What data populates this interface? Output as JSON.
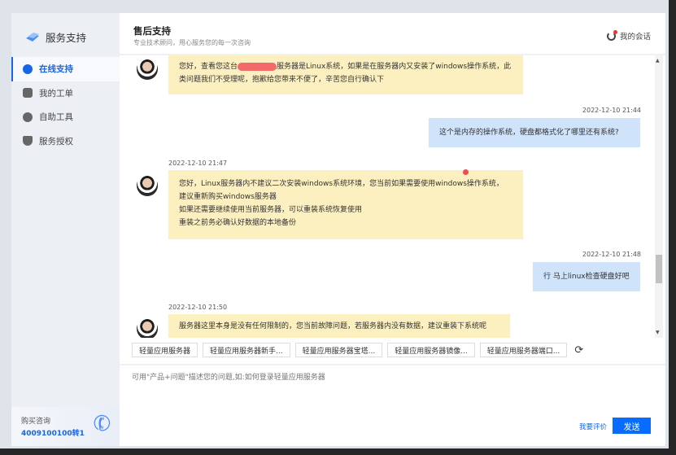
{
  "sidebar": {
    "brand": "服务支持",
    "items": [
      {
        "label": "在线支持",
        "icon": "chat-icon",
        "active": true
      },
      {
        "label": "我的工单",
        "icon": "clipboard-icon"
      },
      {
        "label": "自助工具",
        "icon": "wrench-icon"
      },
      {
        "label": "服务授权",
        "icon": "shield-icon"
      }
    ],
    "buy": {
      "title": "购买咨询",
      "phone": "4009100100转1"
    }
  },
  "header": {
    "title": "售后支持",
    "subtitle": "专业技术顾问，用心服务您的每一次咨询",
    "my_sessions": "我的会话"
  },
  "messages": [
    {
      "from": "agent",
      "text_a": "您好，查看您这台",
      "text_b": "服务器是Linux系统，如果是在服务器内又安装了windows操作系统，此类问题我们不受理呢，抱歉给您带来不便了，辛苦您自行确认下"
    },
    {
      "from": "user",
      "time": "2022-12-10 21:44",
      "text": "这个是内存的操作系统，硬盘都格式化了哪里还有系统?"
    },
    {
      "from": "agent",
      "time": "2022-12-10 21:47",
      "lines": [
        "您好，Linux服务器内不建议二次安装windows系统环境，您当前如果需要使用windows操作系统，",
        "建议重新购买windows服务器",
        "如果还需要继续使用当前服务器，可以重装系统恢复使用",
        "重装之前务必确认好数据的本地备份"
      ]
    },
    {
      "from": "user",
      "time": "2022-12-10 21:48",
      "text": "行 马上linux检查硬盘好吧"
    },
    {
      "from": "agent",
      "time": "2022-12-10 21:50",
      "text": "服务器这里本身是没有任何限制的，您当前故障问题，若服务器内没有数据，建议重装下系统呢"
    }
  ],
  "quick": [
    "轻量应用服务器",
    "轻量应用服务器新手...",
    "轻量应用服务器宝塔...",
    "轻量应用服务器镜像...",
    "轻量应用服务器端口..."
  ],
  "composer": {
    "placeholder": "可用\"产品+问题\"描述您的问题,如:如何登录轻量应用服务器",
    "rate": "我要评价",
    "send": "发送"
  },
  "colors": {
    "accent": "#0a6cff",
    "agent_bubble": "#fdf0c0",
    "user_bubble": "#cfe3fb"
  }
}
